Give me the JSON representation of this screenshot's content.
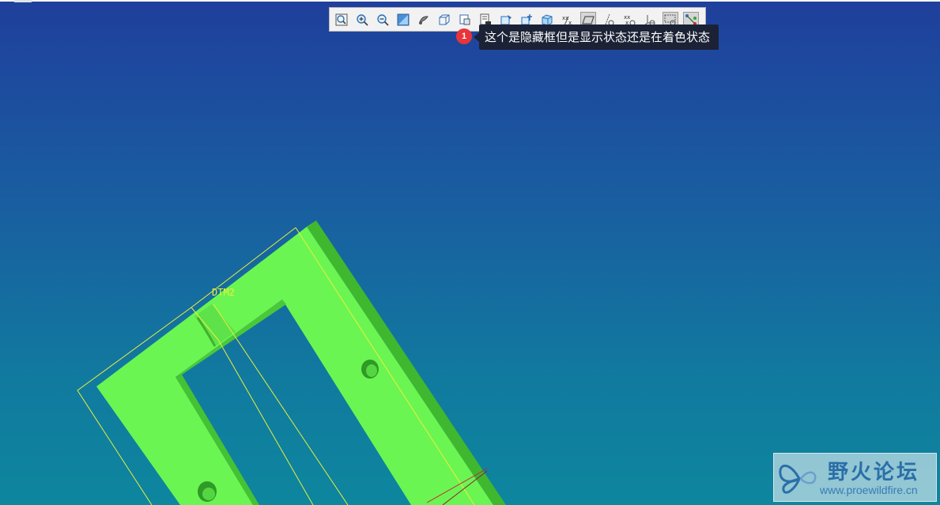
{
  "toolbar": {
    "buttons": [
      {
        "name": "refit",
        "icon": "refit-icon",
        "active": false
      },
      {
        "name": "zoom-in",
        "icon": "zoom-in-icon",
        "active": false
      },
      {
        "name": "zoom-out",
        "icon": "zoom-out-icon",
        "active": false
      },
      {
        "name": "repaint",
        "icon": "repaint-icon",
        "active": false
      },
      {
        "name": "spin-center",
        "icon": "spin-center-icon",
        "active": false
      },
      {
        "name": "display-style",
        "icon": "display-style-icon",
        "active": false
      },
      {
        "name": "saved-orientations",
        "icon": "saved-views-icon",
        "active": false
      },
      {
        "name": "view-manager",
        "icon": "view-manager-icon",
        "active": false
      },
      {
        "name": "perspective",
        "icon": "perspective-icon",
        "active": false
      },
      {
        "name": "section",
        "icon": "section-icon",
        "active": false
      },
      {
        "name": "appearance",
        "icon": "appearance-icon",
        "active": false
      },
      {
        "name": "annotation-display",
        "icon": "annotation-icon",
        "active": false
      },
      {
        "name": "datum-planes",
        "icon": "datum-plane-icon",
        "active": true
      },
      {
        "name": "datum-axes",
        "icon": "datum-axis-icon",
        "active": false
      },
      {
        "name": "datum-points",
        "icon": "datum-point-icon",
        "active": false
      },
      {
        "name": "coordinate-systems",
        "icon": "csys-icon",
        "active": false
      },
      {
        "name": "spin-center-toggle",
        "icon": "spin-toggle-icon",
        "active": true
      },
      {
        "name": "hidden-box",
        "icon": "hidden-box-icon",
        "active": true
      }
    ]
  },
  "annotation": {
    "badge": "1",
    "tooltip_text": "这个是隐藏框但是显示状态还是在着色状态"
  },
  "model": {
    "datum_label": "DTM2",
    "color": "#6bf552",
    "side_color": "#3fb82f",
    "datum_color": "#e8f03a"
  },
  "watermark": {
    "title": "野火论坛",
    "url": "www.proewildfire.cn"
  },
  "colors": {
    "background_top": "#1f3f9c",
    "background_bottom": "#0d869e",
    "tooltip_bg": "#1b2236",
    "badge": "#e8343a"
  }
}
